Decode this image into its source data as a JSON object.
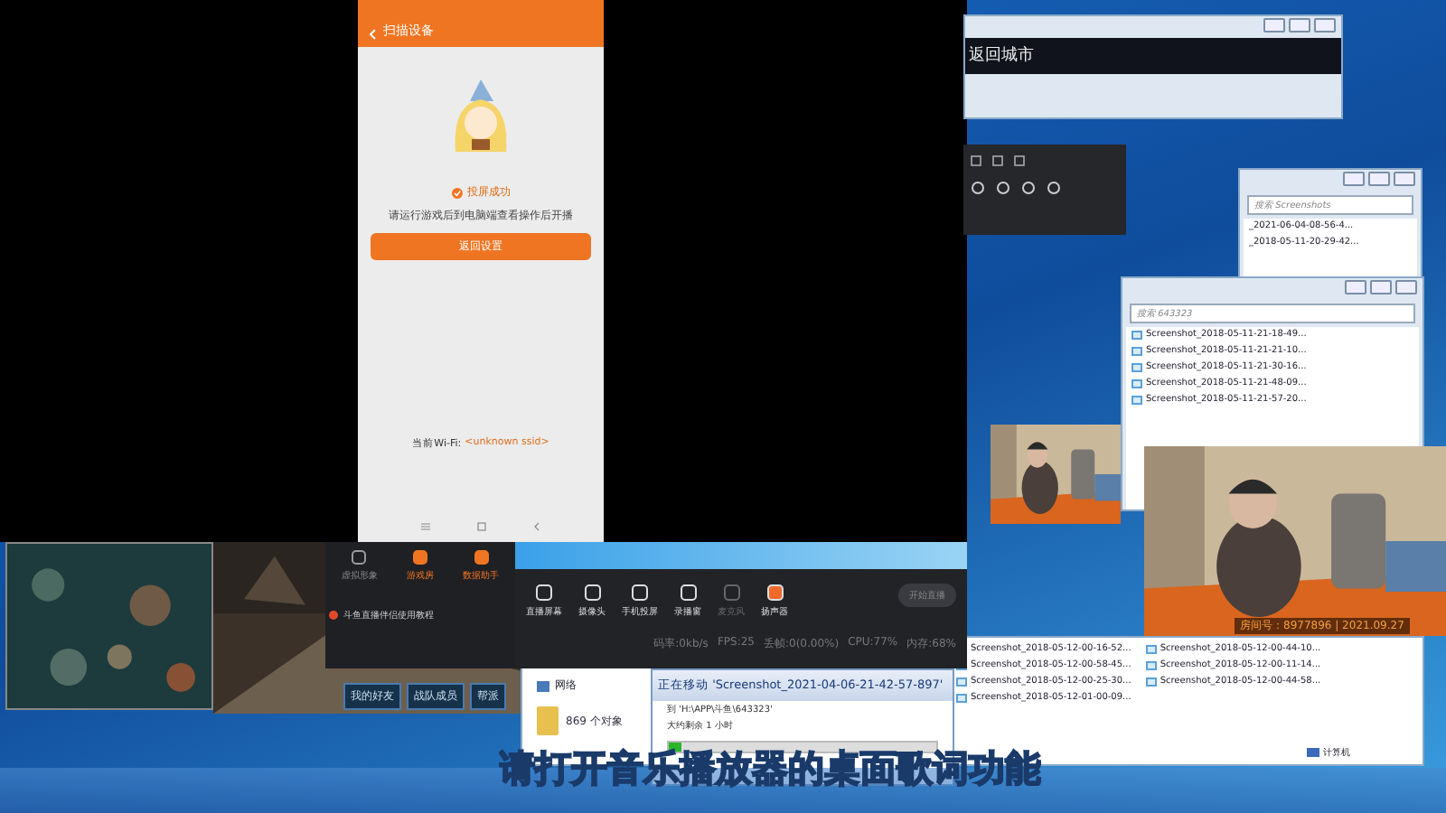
{
  "phone": {
    "title": "扫描设备",
    "status": "投屏成功",
    "message": "请运行游戏后到电脑端查看操作后开播",
    "button": "返回设置",
    "wifi_label": "当前Wi-Fi:",
    "wifi_value": "<unknown ssid>"
  },
  "city_window": {
    "title": "返回城市"
  },
  "explorer_back": {
    "search_placeholder": "搜索 Screenshots",
    "files": [
      "_2021-06-04-08-56-4...",
      "_2018-05-11-20-29-42..."
    ]
  },
  "explorer_front": {
    "search_placeholder": "搜索 643323",
    "files": [
      "Screenshot_2018-05-11-21-18-49...",
      "Screenshot_2018-05-11-21-21-10...",
      "Screenshot_2018-05-11-21-30-16...",
      "Screenshot_2018-05-11-21-48-09...",
      "Screenshot_2018-05-11-21-57-20..."
    ]
  },
  "explorer_bottom": {
    "nav": "网络",
    "count": "869 个对象",
    "status": "计算机",
    "files": [
      "Screenshot_2018-05-12-00-16-52...",
      "Screenshot_2018-05-12-00-44-10...",
      "Screenshot_2018-05-12-00-58-45...",
      "Screenshot_2018-05-12-00-11-14...",
      "Screenshot_2018-05-12-00-25-30...",
      "Screenshot_2018-05-12-00-44-58...",
      "Screenshot_2018-05-12-01-00-09..."
    ]
  },
  "webcam": {
    "caption": "房间号：8977896 | 2021.09.27"
  },
  "side_panel": {
    "items": [
      {
        "label": "虚拟形象",
        "active": false
      },
      {
        "label": "游戏房",
        "active": true
      },
      {
        "label": "数据助手",
        "active": true
      }
    ],
    "notice": "斗鱼直播伴侣使用教程"
  },
  "toolbar": {
    "tools": [
      {
        "label": "直播屏幕",
        "on": true
      },
      {
        "label": "摄像头",
        "on": true
      },
      {
        "label": "手机投屏",
        "on": true
      },
      {
        "label": "录播窗",
        "on": true
      },
      {
        "label": "麦克风",
        "on": false
      },
      {
        "label": "扬声器",
        "on": true
      }
    ],
    "start_button": "开始直播",
    "stats": [
      "码率:0kb/s",
      "FPS:25",
      "丢帧:0(0.00%)",
      "CPU:77%",
      "内存:68%"
    ]
  },
  "game_buttons": [
    "我的好友",
    "战队成员",
    "帮派"
  ],
  "copy_dialog": {
    "title": "正在移动 'Screenshot_2021-04-06-21-42-57-897'",
    "destination": "到 'H:\\APP\\斗鱼\\643323'",
    "remaining": "大约剩余 1 小时",
    "level": 0.05
  },
  "subtitle": "请打开音乐播放器的桌面歌词功能"
}
